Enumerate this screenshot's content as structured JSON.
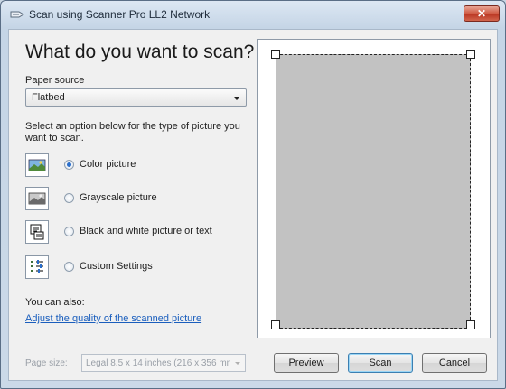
{
  "window": {
    "title": "Scan using Scanner Pro LL2 Network",
    "close_label": "✕"
  },
  "main": {
    "heading": "What do you want to scan?",
    "paper_source_label": "Paper source",
    "paper_source_value": "Flatbed",
    "description": "Select an option below for the type of picture you want to scan.",
    "options": [
      {
        "label": "Color picture",
        "icon": "color-picture-icon",
        "selected": true
      },
      {
        "label": "Grayscale picture",
        "icon": "grayscale-picture-icon",
        "selected": false
      },
      {
        "label": "Black and white picture or text",
        "icon": "bw-picture-icon",
        "selected": false
      },
      {
        "label": "Custom Settings",
        "icon": "custom-settings-icon",
        "selected": false
      }
    ],
    "also_label": "You can also:",
    "adjust_link": "Adjust the quality of the scanned picture",
    "page_size_label": "Page size:",
    "page_size_value": "Legal 8.5 x 14 inches (216 x 356 mm)"
  },
  "buttons": {
    "preview": "Preview",
    "scan": "Scan",
    "cancel": "Cancel"
  },
  "colors": {
    "link": "#1a5ebd",
    "selected_radio": "#2a6ecb"
  }
}
